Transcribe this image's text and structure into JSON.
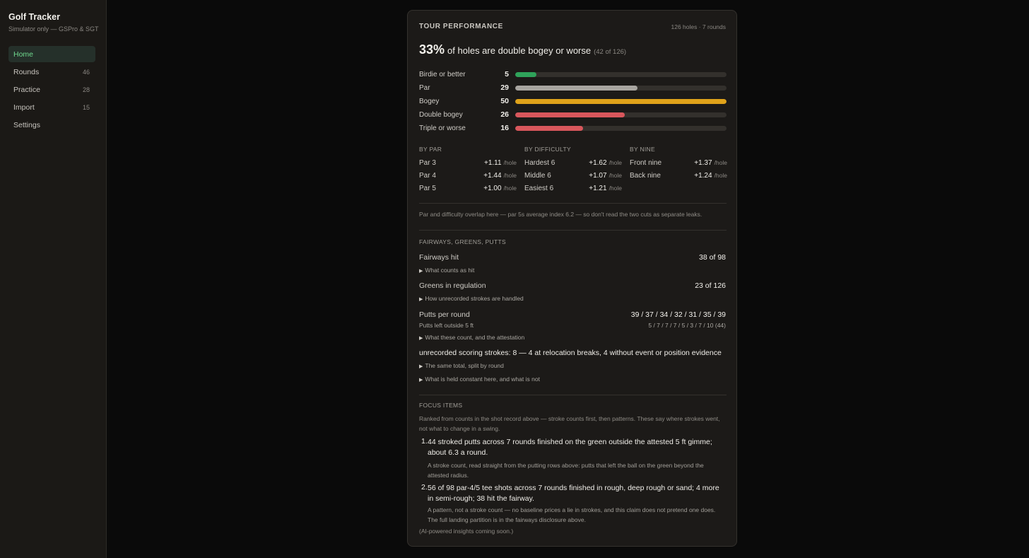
{
  "app": {
    "title": "Golf Tracker",
    "subtitle": "Simulator only — GSPro & SGT"
  },
  "sidebar": {
    "items": [
      {
        "label": "Home",
        "count": ""
      },
      {
        "label": "Rounds",
        "count": "46"
      },
      {
        "label": "Practice",
        "count": "28"
      },
      {
        "label": "Import",
        "count": "15"
      },
      {
        "label": "Settings",
        "count": ""
      }
    ]
  },
  "card": {
    "title": "TOUR PERFORMANCE",
    "meta": "126 holes · 7 rounds",
    "headline": {
      "pct": "33%",
      "text": "of holes are double bogey or worse",
      "detail": "(42 of 126)"
    },
    "distribution": [
      {
        "label": "Birdie or better",
        "value": 5,
        "display": "5",
        "color": "#2fa35a"
      },
      {
        "label": "Par",
        "value": 29,
        "display": "29",
        "color": "#a8a5a0"
      },
      {
        "label": "Bogey",
        "value": 50,
        "display": "50",
        "color": "#e0a31a"
      },
      {
        "label": "Double bogey",
        "value": 26,
        "display": "26",
        "color": "#d9575c"
      },
      {
        "label": "Triple or worse",
        "value": 16,
        "display": "16",
        "color": "#d9575c"
      }
    ],
    "distribution_max": 50,
    "splits": [
      {
        "heading": "BY PAR",
        "rows": [
          {
            "label": "Par 3",
            "value": "+1.11",
            "unit": "/hole"
          },
          {
            "label": "Par 4",
            "value": "+1.44",
            "unit": "/hole"
          },
          {
            "label": "Par 5",
            "value": "+1.00",
            "unit": "/hole"
          }
        ]
      },
      {
        "heading": "BY DIFFICULTY",
        "rows": [
          {
            "label": "Hardest 6",
            "value": "+1.62",
            "unit": "/hole"
          },
          {
            "label": "Middle 6",
            "value": "+1.07",
            "unit": "/hole"
          },
          {
            "label": "Easiest 6",
            "value": "+1.21",
            "unit": "/hole"
          }
        ]
      },
      {
        "heading": "BY NINE",
        "rows": [
          {
            "label": "Front nine",
            "value": "+1.37",
            "unit": "/hole"
          },
          {
            "label": "Back nine",
            "value": "+1.24",
            "unit": "/hole"
          }
        ]
      }
    ],
    "overlap_note": "Par and difficulty overlap here — par 5s average index 6.2 — so don't read the two cuts as separate leaks.",
    "fgp": {
      "heading": "FAIRWAYS, GREENS, PUTTS",
      "fairways_label": "Fairways hit",
      "fairways_value": "38 of 98",
      "fairways_disclosure": "What counts as hit",
      "gir_label": "Greens in regulation",
      "gir_value": "23 of 126",
      "gir_disclosure": "How unrecorded strokes are handled",
      "putts_label": "Putts per round",
      "putts_value": "39 / 37 / 34 / 32 / 31 / 35 / 39",
      "outside_label": "Putts left outside 5 ft",
      "outside_value": "5 / 7 / 7 / 7 / 5 / 3 / 7 / 10 (44)",
      "putts_disclosure": "What these count, and the attestation",
      "unrecorded": "unrecorded scoring strokes: 8 — 4 at relocation breaks, 4 without event or position evidence",
      "split_disclosure": "The same total, split by round",
      "constant_disclosure": "What is held constant here, and what is not"
    },
    "focus": {
      "heading": "FOCUS ITEMS",
      "intro": "Ranked from counts in the shot record above — stroke counts first, then patterns. These say where strokes went, not what to change in a swing.",
      "items": [
        {
          "num": "1.",
          "text": "44 stroked putts across 7 rounds finished on the green outside the attested 5 ft gimme; about 6.3 a round.",
          "detail": "A stroke count, read straight from the putting rows above: putts that left the ball on the green beyond the attested radius."
        },
        {
          "num": "2.",
          "text": "56 of 98 par-4/5 tee shots across 7 rounds finished in rough, deep rough or sand; 4 more in semi-rough; 38 hit the fairway.",
          "detail": "A pattern, not a stroke count — no baseline prices a lie in strokes, and this claim does not pretend one does. The full landing partition is in the fairways disclosure above."
        }
      ],
      "footer": "(AI-powered insights coming soon.)"
    }
  }
}
